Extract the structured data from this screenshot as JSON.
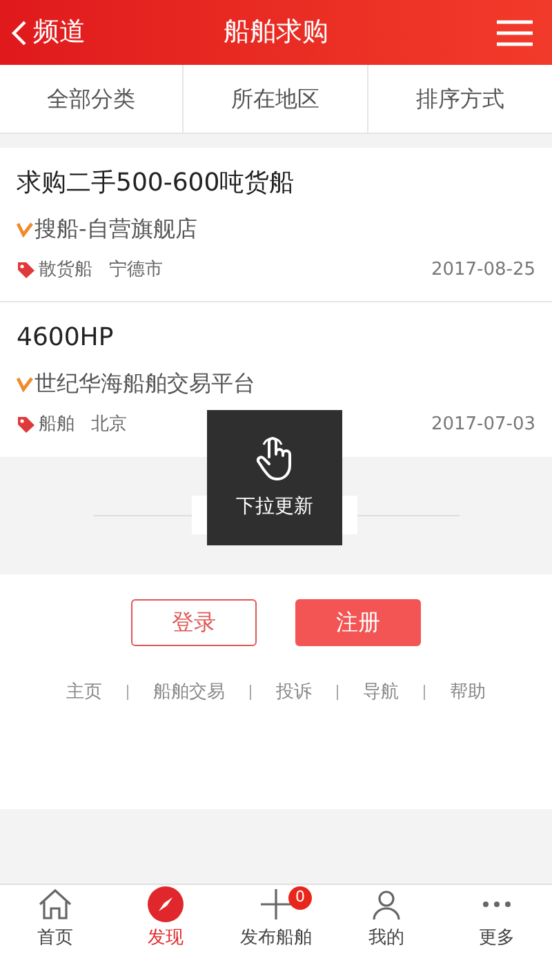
{
  "header": {
    "back_label": "频道",
    "title": "船舶求购"
  },
  "filters": [
    {
      "label": "全部分类"
    },
    {
      "label": "所在地区"
    },
    {
      "label": "排序方式"
    }
  ],
  "listings": [
    {
      "title": "求购二手500-600吨货船",
      "seller": "搜船-自营旗舰店",
      "category": "散货船",
      "location": "宁德市",
      "date": "2017-08-25"
    },
    {
      "title": "4600HP",
      "seller": "世纪华海船舶交易平台",
      "category": "船舶",
      "location": "北京",
      "date": "2017-07-03"
    }
  ],
  "toast": {
    "text": "下拉更新"
  },
  "auth_buttons": [
    {
      "label": "登录",
      "kind": "outline"
    },
    {
      "label": "注册",
      "kind": "filled"
    }
  ],
  "footer_links": [
    "主页",
    "船舶交易",
    "投诉",
    "导航",
    "帮助"
  ],
  "bottom_nav": [
    {
      "label": "首页",
      "kind": "home",
      "selected": false
    },
    {
      "label": "发现",
      "kind": "compass",
      "selected": true
    },
    {
      "label": "发布船舶",
      "kind": "plus",
      "selected": false,
      "badge": "0"
    },
    {
      "label": "我的",
      "kind": "person",
      "selected": false
    },
    {
      "label": "更多",
      "kind": "more",
      "selected": false
    }
  ]
}
